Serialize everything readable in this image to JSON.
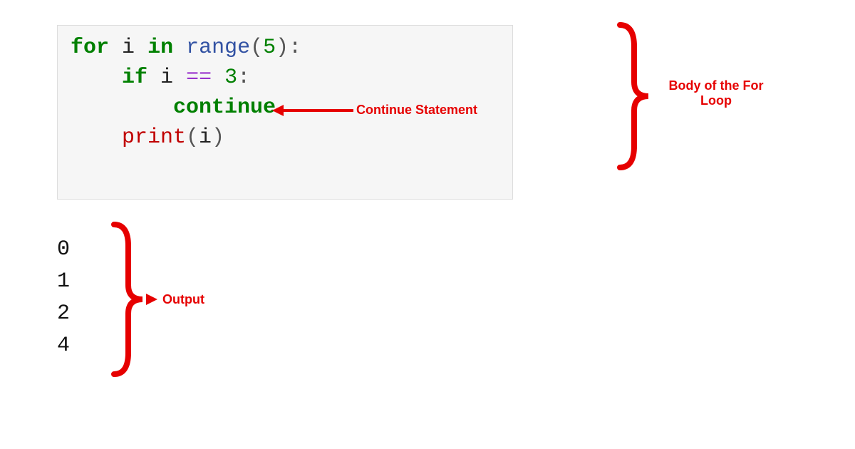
{
  "code": {
    "line1": {
      "kw_for": "for",
      "var_i": "i",
      "kw_in": "in",
      "fn_range": "range",
      "lp": "(",
      "n5": "5",
      "rp": ")",
      "colon": ":"
    },
    "line2": {
      "indent": "    ",
      "kw_if": "if",
      "var_i": "i",
      "op_eq": "==",
      "n3": "3",
      "colon": ":"
    },
    "line3": {
      "indent": "        ",
      "kw_continue": "continue"
    },
    "line4": {
      "indent": "    ",
      "fn_print": "print",
      "lp": "(",
      "var_i": "i",
      "rp": ")"
    }
  },
  "labels": {
    "continue_stmt": "Continue Statement",
    "body_for_loop": "Body of the For Loop",
    "output": "Output"
  },
  "output_lines": [
    "0",
    "1",
    "2",
    "4"
  ]
}
